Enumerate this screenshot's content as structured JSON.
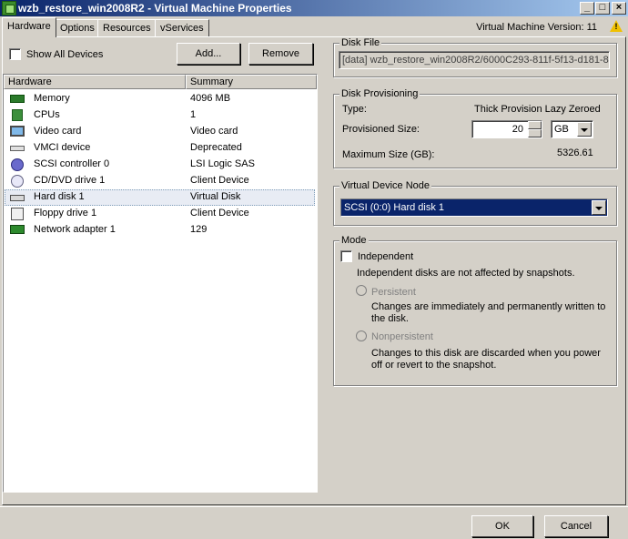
{
  "window": {
    "title": "wzb_restore_win2008R2 - Virtual Machine Properties",
    "minimize_glyph": "_",
    "maximize_glyph": "□",
    "close_glyph": "×"
  },
  "tabs": [
    {
      "label": "Hardware"
    },
    {
      "label": "Options"
    },
    {
      "label": "Resources"
    },
    {
      "label": "vServices"
    }
  ],
  "vm_version_label": "Virtual Machine Version: 11",
  "hardware_panel": {
    "show_all_devices_label": "Show All Devices",
    "add_button": "Add...",
    "remove_button": "Remove",
    "columns": {
      "hardware": "Hardware",
      "summary": "Summary"
    },
    "devices": [
      {
        "name": "Memory",
        "summary": "4096 MB",
        "icon": "memory-icon"
      },
      {
        "name": "CPUs",
        "summary": "1",
        "icon": "cpu-icon"
      },
      {
        "name": "Video card",
        "summary": "Video card",
        "icon": "monitor-icon"
      },
      {
        "name": "VMCI device",
        "summary": "Deprecated",
        "icon": "vmci-icon"
      },
      {
        "name": "SCSI controller 0",
        "summary": "LSI Logic SAS",
        "icon": "scsi-icon"
      },
      {
        "name": "CD/DVD drive 1",
        "summary": "Client Device",
        "icon": "cd-icon"
      },
      {
        "name": "Hard disk 1",
        "summary": "Virtual Disk",
        "icon": "harddisk-icon"
      },
      {
        "name": "Floppy drive 1",
        "summary": "Client Device",
        "icon": "floppy-icon"
      },
      {
        "name": "Network adapter 1",
        "summary": "129",
        "icon": "network-icon"
      }
    ],
    "selected_device": "Hard disk 1"
  },
  "disk_file": {
    "label": "Disk File",
    "value": "[data] wzb_restore_win2008R2/6000C293-811f-5f13-d181-8"
  },
  "disk_provisioning": {
    "label": "Disk Provisioning",
    "type_label": "Type:",
    "type_value": "Thick Provision Lazy Zeroed",
    "provisioned_size_label": "Provisioned Size:",
    "provisioned_size_value": "20",
    "unit_value": "GB",
    "max_size_label": "Maximum Size (GB):",
    "max_size_value": "5326.61"
  },
  "virtual_device_node": {
    "label": "Virtual Device Node",
    "value": "SCSI (0:0) Hard disk 1"
  },
  "mode": {
    "label": "Mode",
    "independent_label": "Independent",
    "independent_desc": "Independent disks are not affected by snapshots.",
    "persistent_label": "Persistent",
    "persistent_desc_1": "Changes are immediately and permanently written to",
    "persistent_desc_2": "the disk.",
    "nonpersistent_label": "Nonpersistent",
    "nonpersistent_desc_1": "Changes to this disk are discarded when you power",
    "nonpersistent_desc_2": "off or revert to the snapshot."
  },
  "footer": {
    "ok_button": "OK",
    "cancel_button": "Cancel"
  },
  "colors": {
    "title_bar": "#0a246a",
    "selected_field": "#0a246a",
    "window_bg": "#d4d0c8"
  }
}
